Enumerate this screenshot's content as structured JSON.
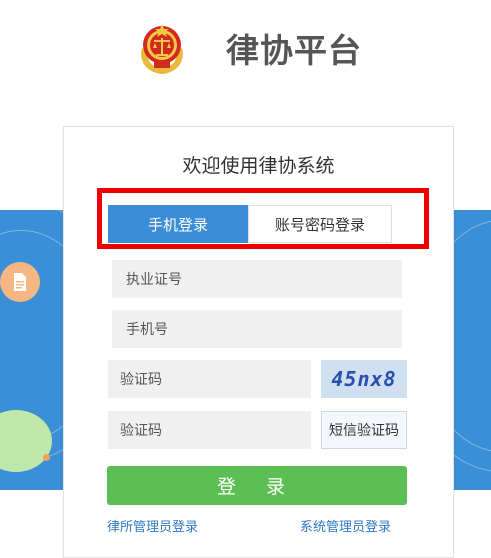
{
  "header": {
    "title": "律协平台",
    "logo_icon": "court-emblem-icon"
  },
  "login": {
    "welcome": "欢迎使用律协系统",
    "tabs": [
      {
        "label": "手机登录",
        "active": true
      },
      {
        "label": "账号密码登录",
        "active": false
      }
    ],
    "fields": {
      "license_placeholder": "执业证号",
      "phone_placeholder": "手机号",
      "captcha_placeholder": "验证码",
      "sms_code_placeholder": "验证码"
    },
    "captcha_text": "45nx8",
    "sms_button": "短信验证码",
    "submit": "登 录",
    "links": {
      "firm_admin": "律所管理员登录",
      "system_admin": "系统管理员登录"
    }
  },
  "colors": {
    "primary_blue": "#3b8ed6",
    "login_green": "#5cbf53",
    "highlight_red": "#ef0000",
    "title_gray": "#555555"
  }
}
